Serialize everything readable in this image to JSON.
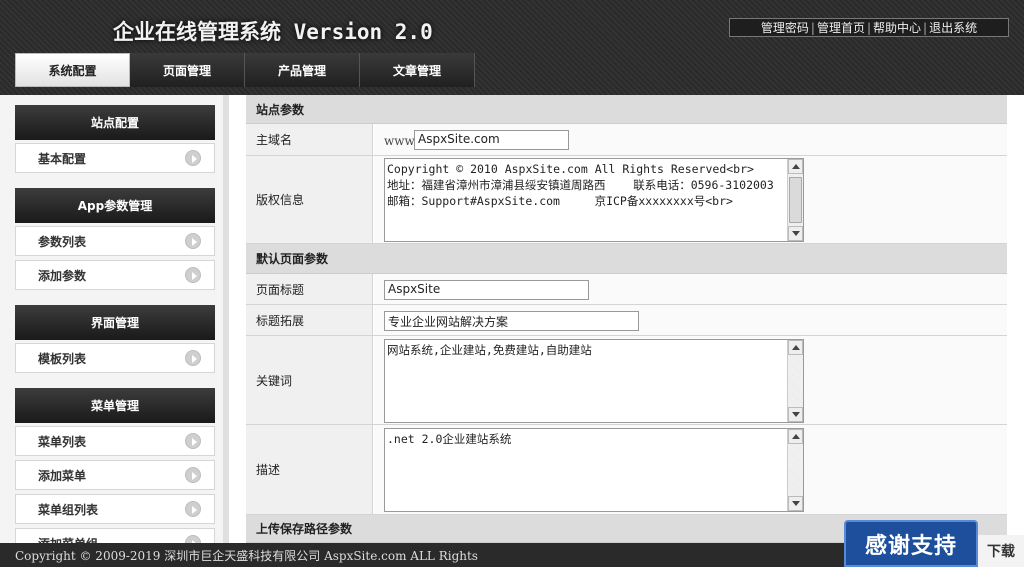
{
  "header": {
    "title": "企业在线管理系统 Version 2.0",
    "toplinks": [
      "管理密码",
      "管理首页",
      "帮助中心",
      "退出系统"
    ],
    "separator": "|",
    "tabs": [
      "系统配置",
      "页面管理",
      "产品管理",
      "文章管理"
    ]
  },
  "sidebar": {
    "groups": [
      {
        "title": "站点配置",
        "items": [
          "基本配置"
        ]
      },
      {
        "title": "App参数管理",
        "items": [
          "参数列表",
          "添加参数"
        ]
      },
      {
        "title": "界面管理",
        "items": [
          "模板列表"
        ]
      },
      {
        "title": "菜单管理",
        "items": [
          "菜单列表",
          "添加菜单",
          "菜单组列表",
          "添加菜单组"
        ]
      }
    ]
  },
  "main": {
    "section1": "站点参数",
    "domain_label": "主域名",
    "domain_prefix": "www.",
    "domain_value": "AspxSite.com",
    "copyright_label": "版权信息",
    "copyright_value": "Copyright © 2010 AspxSite.com All Rights Reserved<br>\n地址：福建省漳州市漳浦县绥安镇道周路西    联系电话：0596-3102003    邮箱：Support#AspxSite.com     京ICP备xxxxxxxx号<br>",
    "section2": "默认页面参数",
    "page_title_label": "页面标题",
    "page_title_value": "AspxSite",
    "title_ext_label": "标题拓展",
    "title_ext_value": "专业企业网站解决方案",
    "keywords_label": "关键词",
    "keywords_value": "网站系统,企业建站,免费建站,自助建站",
    "desc_label": "描述",
    "desc_value": ".net 2.0企业建站系统",
    "section3": "上传保存路径参数"
  },
  "footer": {
    "text": "Copyright © 2009-2019 深圳市巨企天盛科技有限公司  AspxSite.com ALL Rights"
  },
  "overlay": {
    "badge": "感谢支持",
    "badge2": "下载"
  }
}
